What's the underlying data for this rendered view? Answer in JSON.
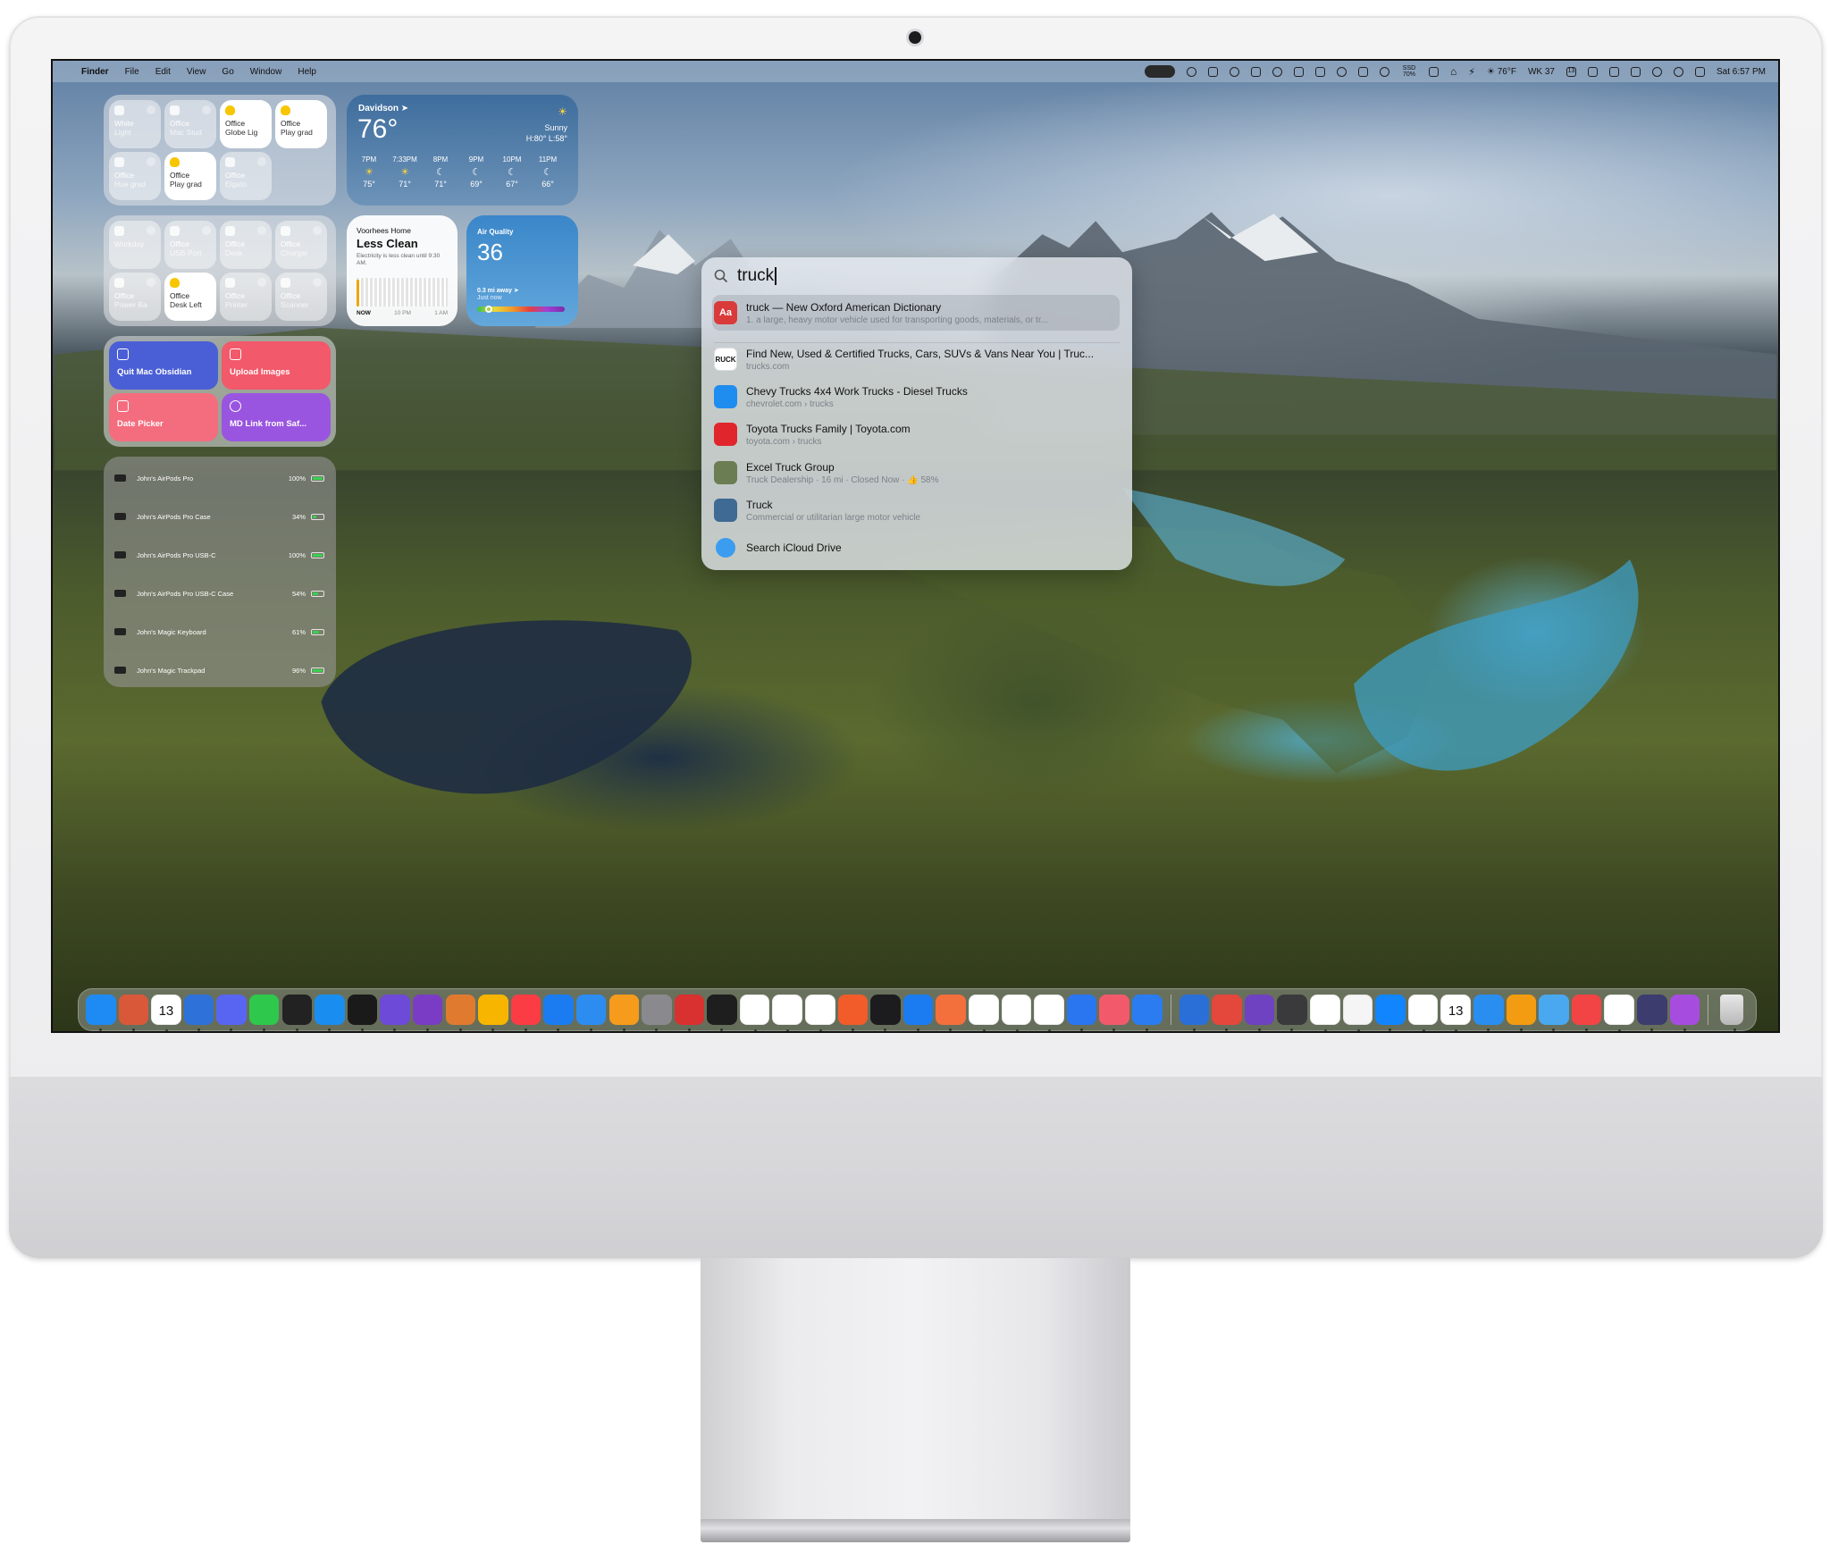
{
  "menubar": {
    "app_name": "Finder",
    "menus": [
      "File",
      "Edit",
      "View",
      "Go",
      "Window",
      "Help"
    ],
    "weather": "76°F",
    "week": "WK 37",
    "ssd": "SSD 70%",
    "calendar_day": "13",
    "datetime": "Sat 6:57 PM"
  },
  "home_widget_1": {
    "tiles": [
      {
        "title": "White",
        "sub": "Light",
        "on": false
      },
      {
        "title": "Office",
        "sub": "Mac Stud",
        "on": false
      },
      {
        "title": "Office",
        "sub": "Globe Lig",
        "on": true
      },
      {
        "title": "Office",
        "sub": "Play grad",
        "on": true
      },
      {
        "title": "Office",
        "sub": "Hue grad",
        "on": false
      },
      {
        "title": "Office",
        "sub": "Play grad",
        "on": true
      },
      {
        "title": "Office",
        "sub": "Elgato",
        "on": false
      }
    ]
  },
  "home_widget_2": {
    "tiles": [
      {
        "title": "",
        "sub": "Workday",
        "on": false
      },
      {
        "title": "Office",
        "sub": "USB Port",
        "on": false
      },
      {
        "title": "Office",
        "sub": "Desk",
        "on": false
      },
      {
        "title": "Office",
        "sub": "Charger",
        "on": false
      },
      {
        "title": "Office",
        "sub": "Power Ba",
        "on": false
      },
      {
        "title": "Office",
        "sub": "Desk Left",
        "on": true
      },
      {
        "title": "Office",
        "sub": "Printer",
        "on": false
      },
      {
        "title": "Office",
        "sub": "Scanner",
        "on": false
      }
    ]
  },
  "shortcuts": [
    {
      "label": "Quit Mac Obsidian",
      "color": "#4a5fd6"
    },
    {
      "label": "Upload Images",
      "color": "#f2596a"
    },
    {
      "label": "Date Picker",
      "color": "#f46d7e"
    },
    {
      "label": "MD Link from Saf...",
      "color": "#9a55e0"
    }
  ],
  "batteries": [
    {
      "name": "John's AirPods Pro",
      "percent": "100%",
      "level": 1.0
    },
    {
      "name": "John's AirPods Pro Case",
      "percent": "34%",
      "level": 0.34
    },
    {
      "name": "John's AirPods Pro USB-C",
      "percent": "100%",
      "level": 1.0
    },
    {
      "name": "John's AirPods Pro USB-C Case",
      "percent": "54%",
      "level": 0.54
    },
    {
      "name": "John's Magic Keyboard",
      "percent": "61%",
      "level": 0.61
    },
    {
      "name": "John's Magic Trackpad",
      "percent": "96%",
      "level": 0.96
    }
  ],
  "weather": {
    "location": "Davidson",
    "temp": "76°",
    "condition": "Sunny",
    "hilo": "H:80° L:58°",
    "hours": [
      {
        "time": "7PM",
        "glyph": "☀",
        "temp": "75°"
      },
      {
        "time": "7:33PM",
        "glyph": "☀",
        "temp": "71°"
      },
      {
        "time": "8PM",
        "glyph": "☾",
        "temp": "71°"
      },
      {
        "time": "9PM",
        "glyph": "☾",
        "temp": "69°"
      },
      {
        "time": "10PM",
        "glyph": "☾",
        "temp": "67°"
      },
      {
        "time": "11PM",
        "glyph": "☾",
        "temp": "66°"
      }
    ]
  },
  "electricity": {
    "location": "Voorhees Home",
    "status": "Less Clean",
    "note": "Electricity is less clean until 9:30 AM.",
    "axis": [
      "NOW",
      "10 PM",
      "1 AM"
    ]
  },
  "air_quality": {
    "label": "Air Quality",
    "value": "36",
    "distance": "0.3 mi away",
    "updated": "Just now"
  },
  "spotlight": {
    "query": "truck",
    "results": [
      {
        "title": "truck — New Oxford American Dictionary",
        "sub": "1. a large, heavy motor vehicle used for transporting goods, materials, or tr...",
        "icon": "Aa",
        "color": "#d93a3a"
      },
      {
        "title": "Find New, Used & Certified Trucks, Cars, SUVs & Vans Near You | Truc...",
        "sub": "trucks.com",
        "icon": "RUCK",
        "color": "#ffffff"
      },
      {
        "title": "Chevy Trucks 4x4 Work Trucks - Diesel Trucks",
        "sub": "chevrolet.com › trucks",
        "icon": "",
        "color": "#1f8cf0"
      },
      {
        "title": "Toyota Trucks Family | Toyota.com",
        "sub": "toyota.com › trucks",
        "icon": "",
        "color": "#e0262c"
      },
      {
        "title": "Excel Truck Group",
        "sub": "Truck Dealership · 16 mi · Closed Now · 👍 58%",
        "icon": "",
        "color": "#6b7d52"
      },
      {
        "title": "Truck",
        "sub": "Commercial or utilitarian large motor vehicle",
        "icon": "",
        "color": "#3e6a93"
      },
      {
        "title": "Search iCloud Drive",
        "sub": "",
        "icon": "",
        "color": "#3b9cf0"
      }
    ]
  },
  "dock": {
    "calendar_day": "13",
    "apps": [
      "#1e8bf5",
      "#d9583a",
      "#ffffff",
      "#2d71d9",
      "#5865f2",
      "#2ec84c",
      "#222222",
      "#1a8df0",
      "#1a1a1a",
      "#6e4ad8",
      "#7b3cc5",
      "#e07a2f",
      "#f7b500",
      "#fc3c44",
      "#1a7cf0",
      "#2d8cf0",
      "#f69b1b",
      "#8a8a8e",
      "#d93030",
      "#1e1e1e",
      "#ffffff",
      "#ffffff",
      "#ffffff",
      "#f25c2a",
      "#1c1c1e",
      "#1a7cf0",
      "#f36f3c",
      "#ffffff",
      "#ffffff",
      "#ffffff",
      "#2a75f0",
      "#f25a6c",
      "#2a7cf0",
      "#2a6fd8",
      "#e4473b",
      "#6f42c1",
      "#3a3a3c",
      "#ffffff",
      "#f5f5f5",
      "#1185fe",
      "#ffffff",
      "#ffffff",
      "#2a8ef0",
      "#f39c12",
      "#4aa8f0",
      "#f24444",
      "#ffffff",
      "#3c3c6e",
      "#a64de0"
    ]
  }
}
